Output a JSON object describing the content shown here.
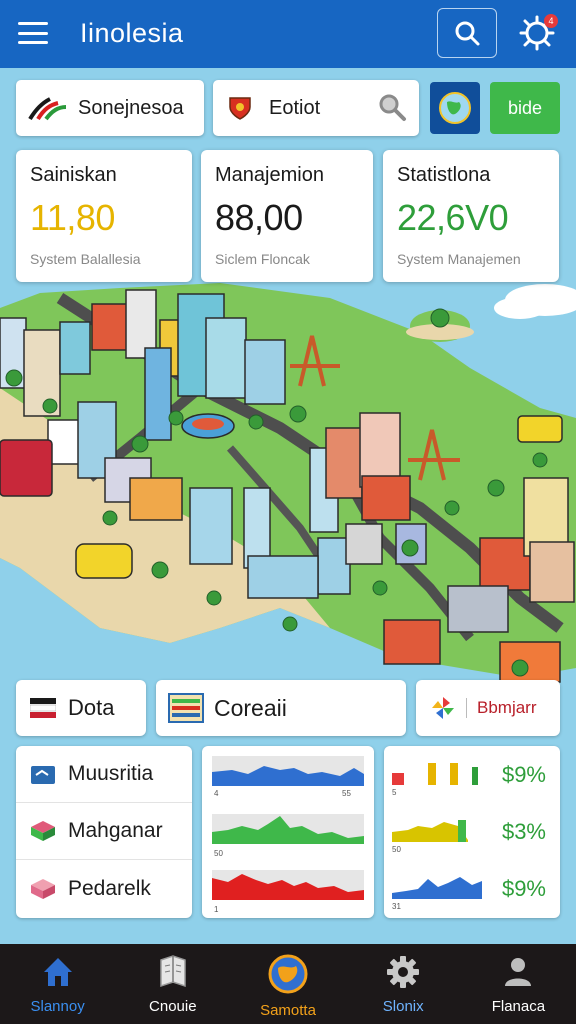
{
  "header": {
    "title": "Iinolesia",
    "notification_count": "4"
  },
  "top_chips": {
    "chip1": {
      "label": "Sonejnesoa",
      "icon": "swoosh-logo-icon"
    },
    "chip2": {
      "label": "Eotiot",
      "icon": "shield-emblem-icon",
      "action_icon": "magnifier-icon"
    },
    "globe": {
      "icon": "globe-icon"
    },
    "button": {
      "label": "bide"
    }
  },
  "stats": [
    {
      "title": "Sainiskan",
      "value": "11,80",
      "subtitle": "System Balallesia",
      "color": "#e6b400"
    },
    {
      "title": "Manajemion",
      "value": "88,00",
      "subtitle": "Siclem Floncak",
      "color": "#1a1a1a"
    },
    {
      "title": "Statistlona",
      "value": "22,6V0",
      "subtitle": "System Manajemen",
      "color": "#2e9e3a"
    }
  ],
  "panel_chips": {
    "dota": {
      "label": "Dota",
      "icon": "flag-icon"
    },
    "coreaii": {
      "label": "Coreaii",
      "icon": "map-card-icon"
    },
    "bbmjarr": {
      "label": "Bbmjarr",
      "icon": "pinwheel-icon"
    }
  },
  "list": [
    {
      "label": "Muusritia",
      "icon": "folder-icon"
    },
    {
      "label": "Mahganar",
      "icon": "box-icon"
    },
    {
      "label": "Pedarelk",
      "icon": "package-icon"
    }
  ],
  "mini_charts": [
    {
      "color": "#2f6fd0",
      "left_label": "4",
      "right_label": "55"
    },
    {
      "color": "#3fb84a",
      "left_label": "50",
      "right_label": ""
    },
    {
      "color": "#e02020",
      "left_label": "1",
      "right_label": ""
    }
  ],
  "pct_rows": [
    {
      "value": "$9%",
      "bar_colors": [
        "#e63a3a",
        "#e6b400",
        "#e6b400",
        "#2e9e3a"
      ],
      "left_label": "5"
    },
    {
      "value": "$3%",
      "bar_colors": [
        "#d8c400",
        "#3fb84a"
      ],
      "left_label": "50"
    },
    {
      "value": "$9%",
      "bar_colors": [
        "#2f6fd0"
      ],
      "left_label": "31"
    }
  ],
  "bottom_nav": [
    {
      "label": "Slannoy",
      "icon": "home-icon",
      "color": "#3a8ff0"
    },
    {
      "label": "Cnouie",
      "icon": "book-icon",
      "color": "#ffffff"
    },
    {
      "label": "Samotta",
      "icon": "globe-icon",
      "color": "#f2a11a"
    },
    {
      "label": "Slonix",
      "icon": "gear-icon",
      "color": "#6fb4ff"
    },
    {
      "label": "Flanaca",
      "icon": "user-icon",
      "color": "#ffffff"
    }
  ]
}
